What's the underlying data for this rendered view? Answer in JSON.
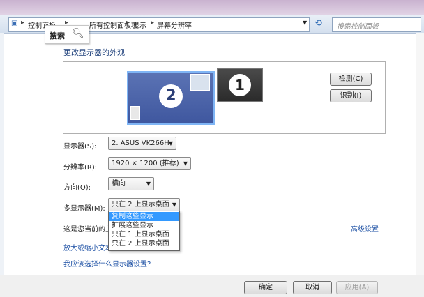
{
  "address": {
    "crumbs": [
      "控制面板",
      "所有控制面板项",
      "显示",
      "屏幕分辨率"
    ],
    "search_placeholder": "搜索控制面板"
  },
  "search_popup": {
    "label": "搜索"
  },
  "page": {
    "title": "更改显示器的外观"
  },
  "preview": {
    "monitor_large": "2",
    "monitor_small": "1"
  },
  "side_buttons": {
    "detect": "检测(C)",
    "identify": "识别(I)"
  },
  "settings": {
    "display_label": "显示器(S):",
    "display_value": "2. ASUS VK266H",
    "resolution_label": "分辨率(R):",
    "resolution_value": "1920 × 1200 (推荐)",
    "orientation_label": "方向(O):",
    "orientation_value": "横向",
    "multi_label": "多显示器(M):",
    "multi_value": "只在 2 上显示桌面"
  },
  "dropdown": {
    "options": [
      "复制这些显示",
      "扩展这些显示",
      "只在 1 上显示桌面",
      "只在 2 上显示桌面"
    ],
    "highlighted_index": 0
  },
  "info": {
    "main_text": "这是您当前的主",
    "advanced": "高级设置",
    "link_text_size": "放大或缩小文本",
    "link_which": "我应该选择什么显示器设置?"
  },
  "footer": {
    "ok": "确定",
    "cancel": "取消",
    "apply": "应用(A)"
  }
}
